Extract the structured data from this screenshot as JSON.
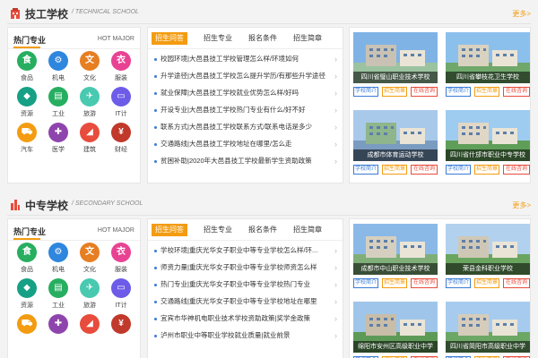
{
  "colors": {
    "accent": "#f39c12",
    "link_blue": "#3a7bd5",
    "consult_red": "#e74c3c"
  },
  "school_buttons": {
    "intro": "学校简介",
    "admissions": "招生简章",
    "consult": "在线咨询"
  },
  "sections": [
    {
      "title": "技工学校",
      "subtitle": "/ TECHNICAL SCHOOL",
      "icon": "building-icon",
      "more": "更多>",
      "majors_title": "热门专业",
      "majors_en": "HOT MAJOR",
      "majors": [
        {
          "label": "食品",
          "icon": "food-icon",
          "color": "#27ae60"
        },
        {
          "label": "机电",
          "icon": "electromech-icon",
          "color": "#2e86de"
        },
        {
          "label": "文化",
          "icon": "culture-icon",
          "color": "#e67e22"
        },
        {
          "label": "服装",
          "icon": "clothing-icon",
          "color": "#e84393"
        },
        {
          "label": "资源",
          "icon": "resource-icon",
          "color": "#16a085"
        },
        {
          "label": "工业",
          "icon": "industry-icon",
          "color": "#27ae60"
        },
        {
          "label": "旅游",
          "icon": "travel-icon",
          "color": "#48c9b0"
        },
        {
          "label": "IT计",
          "icon": "computer-icon",
          "color": "#6c5ce7"
        },
        {
          "label": "汽车",
          "icon": "car-icon",
          "color": "#f39c12"
        },
        {
          "label": "医学",
          "icon": "medical-icon",
          "color": "#8e44ad"
        },
        {
          "label": "建筑",
          "icon": "construction-icon",
          "color": "#e74c3c"
        },
        {
          "label": "财经",
          "icon": "finance-icon",
          "color": "#c0392b"
        }
      ],
      "tabs": [
        "招生问答",
        "招生专业",
        "报名条件",
        "招生简章"
      ],
      "news": [
        "校园环境|大邑县技工学校管理怎么样/环境如何",
        "升学途径|大邑县技工学校怎么提升学历/有那些升学途径",
        "就业保障|大邑县技工学校就业优势怎么样/好吗",
        "开设专业|大邑县技工学校热门专业有什么/好不好",
        "联系方式|大邑县技工学校联系方式/联系电话是多少",
        "交通路线|大邑县技工学校地址在哪里/怎么走",
        "贫困补助|2020年大邑县技工学校最新学生资助政策"
      ],
      "schools": [
        {
          "name": "四川省璧山职业技术学校",
          "img": "campus-a"
        },
        {
          "name": "四川省攀枝花卫生学校",
          "img": "campus-b"
        },
        {
          "name": "成都市体育运动学校",
          "img": "campus-c"
        },
        {
          "name": "四川省什邡市职业中专学校",
          "img": "campus-d"
        }
      ]
    },
    {
      "title": "中专学校",
      "subtitle": "/ SECONDARY SCHOOL",
      "icon": "bar-chart-icon",
      "more": "更多>",
      "majors_title": "热门专业",
      "majors_en": "HOT MAJOR",
      "majors": [
        {
          "label": "食品",
          "icon": "food-icon",
          "color": "#27ae60"
        },
        {
          "label": "机电",
          "icon": "electromech-icon",
          "color": "#2e86de"
        },
        {
          "label": "文化",
          "icon": "culture-icon",
          "color": "#e67e22"
        },
        {
          "label": "服装",
          "icon": "clothing-icon",
          "color": "#e84393"
        },
        {
          "label": "资源",
          "icon": "resource-icon",
          "color": "#16a085"
        },
        {
          "label": "工业",
          "icon": "industry-icon",
          "color": "#27ae60"
        },
        {
          "label": "旅游",
          "icon": "travel-icon",
          "color": "#48c9b0"
        },
        {
          "label": "IT计",
          "icon": "computer-icon",
          "color": "#6c5ce7"
        },
        {
          "label": "",
          "icon": "car-icon",
          "color": "#f39c12"
        },
        {
          "label": "",
          "icon": "medical-icon",
          "color": "#8e44ad"
        },
        {
          "label": "",
          "icon": "construction-icon",
          "color": "#e74c3c"
        },
        {
          "label": "",
          "icon": "finance-icon",
          "color": "#c0392b"
        }
      ],
      "tabs": [
        "招生问答",
        "招生专业",
        "报名条件",
        "招生简章"
      ],
      "news": [
        "学校环境|重庆光华女子职业中等专业学校怎么样/环...",
        "师资力量|重庆光华女子职业中等专业学校师资怎么样",
        "热门专业|重庆光华女子职业中等专业学校热门专业",
        "交通路线|重庆光华女子职业中等专业学校地址在哪里",
        "宜宾市华神机电职业技术学校资助政策|奖学金政策",
        "泸州市职业中等职业学校就业质量|就业前景"
      ],
      "schools": [
        {
          "name": "成都市中山职业技术学校",
          "img": "campus-e"
        },
        {
          "name": "荣县金科职业学校",
          "img": "campus-f"
        },
        {
          "name": "绵阳市安州区高级职业中学",
          "img": "campus-g"
        },
        {
          "name": "四川省简阳市高级职业中学",
          "img": "campus-h"
        }
      ]
    }
  ]
}
